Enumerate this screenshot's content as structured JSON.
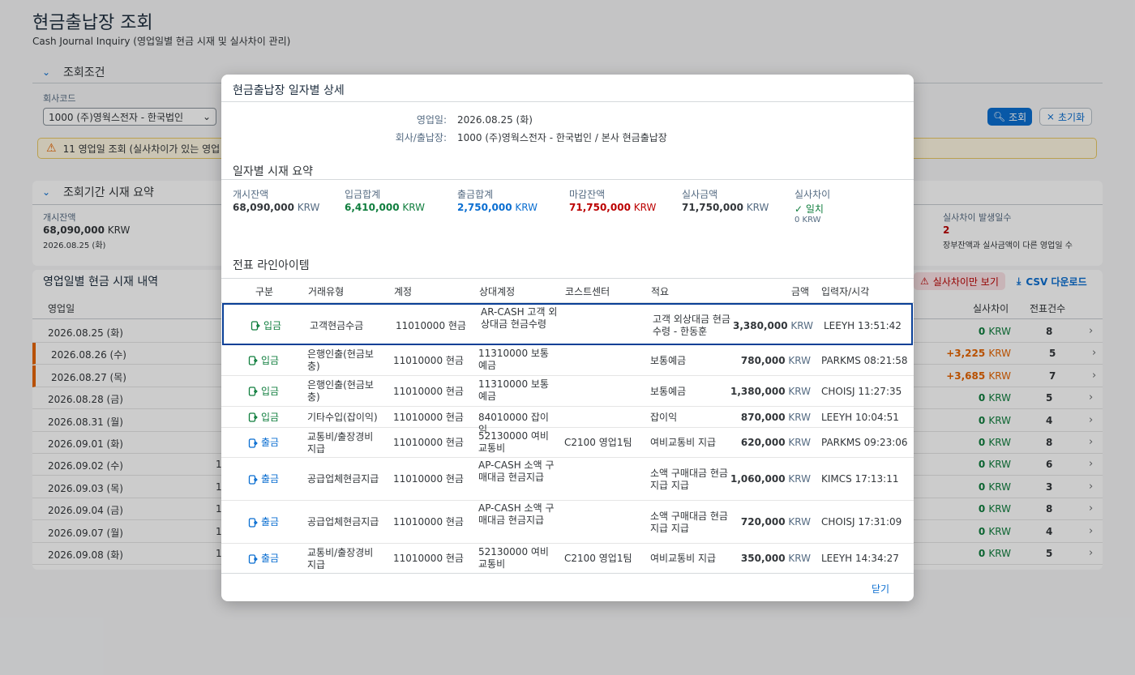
{
  "page": {
    "title": "현금출납장 조회",
    "subtitle": "Cash Journal Inquiry (영업일별 현금 시재 및 실사차이 관리)"
  },
  "filters": {
    "section_label": "조회조건",
    "company_label": "회사코드",
    "company_value": "1000 (주)영웍스전자 - 한국법인",
    "search_label": "조회",
    "reset_label": "초기화",
    "warning_text": "11 영업일 조회 (실사차이가 있는 영업"
  },
  "summary": {
    "section_label": "조회기간 시재 요약",
    "opening_label": "개시잔액",
    "opening_value": "68,090,000",
    "opening_unit": "KRW",
    "opening_date": "2026.08.25 (화)",
    "diff_days_label": "실사차이 발생일수",
    "diff_days_value": "2",
    "diff_days_desc": "장부잔액과 실사금액이 다른 영업일 수"
  },
  "list": {
    "title": "영업일별 현금 시재 내역",
    "only_diff_label": "실사차이만 보기",
    "csv_label": "CSV 다운로드",
    "col_date": "영업일",
    "col_diff": "실사차이",
    "col_count": "전표건수",
    "rows": [
      {
        "date": "2026.08.25 (화)",
        "extra": "",
        "diff": "0",
        "unit": "KRW",
        "count": "8",
        "flag": false
      },
      {
        "date": "2026.08.26 (수)",
        "extra": "",
        "diff": "+3,225",
        "unit": "KRW",
        "count": "5",
        "flag": true
      },
      {
        "date": "2026.08.27 (목)",
        "extra": "",
        "diff": "+3,685",
        "unit": "KRW",
        "count": "7",
        "flag": true
      },
      {
        "date": "2026.08.28 (금)",
        "extra": "",
        "diff": "0",
        "unit": "KRW",
        "count": "5",
        "flag": false
      },
      {
        "date": "2026.08.31 (월)",
        "extra": "",
        "diff": "0",
        "unit": "KRW",
        "count": "4",
        "flag": false
      },
      {
        "date": "2026.09.01 (화)",
        "extra": "",
        "diff": "0",
        "unit": "KRW",
        "count": "8",
        "flag": false
      },
      {
        "date": "2026.09.02 (수)",
        "extra": "1",
        "diff": "0",
        "unit": "KRW",
        "count": "6",
        "flag": false
      },
      {
        "date": "2026.09.03 (목)",
        "extra": "1",
        "diff": "0",
        "unit": "KRW",
        "count": "3",
        "flag": false
      },
      {
        "date": "2026.09.04 (금)",
        "extra": "1",
        "diff": "0",
        "unit": "KRW",
        "count": "8",
        "flag": false
      },
      {
        "date": "2026.09.07 (월)",
        "extra": "1",
        "diff": "0",
        "unit": "KRW",
        "count": "4",
        "flag": false
      },
      {
        "date": "2026.09.08 (화)",
        "extra": "1",
        "diff": "0",
        "unit": "KRW",
        "count": "5",
        "flag": false
      }
    ]
  },
  "dialog": {
    "title": "현금출납장 일자별 상세",
    "biz_date_label": "영업일:",
    "biz_date_value": "2026.08.25 (화)",
    "company_label": "회사/출납장:",
    "company_value": "1000 (주)영웍스전자 - 한국법인 / 본사 현금출납장",
    "daily_section": "일자별 시재 요약",
    "opening_label": "개시잔액",
    "opening_value": "68,090,000",
    "in_label": "입금합계",
    "in_value": "6,410,000",
    "out_label": "출금합계",
    "out_value": "2,750,000",
    "closing_label": "마감잔액",
    "closing_value": "71,750,000",
    "actual_label": "실사금액",
    "actual_value": "71,750,000",
    "diff_label": "실사차이",
    "diff_status": "일치",
    "diff_value": "0 KRW",
    "unit": "KRW",
    "lines_section": "전표 라인아이템",
    "columns": {
      "kind": "구분",
      "type": "거래유형",
      "account": "계정",
      "counter": "상대계정",
      "cost_center": "코스트센터",
      "memo": "적요",
      "amount": "금액",
      "entered": "입력자/시각"
    },
    "lines": [
      {
        "kind": "입금",
        "dir": "in",
        "type": "고객현금수금",
        "account": "11010000 현금",
        "counter": "AR-CASH 고객 외상대금 현금수령",
        "cc": "",
        "memo": "고객 외상대금 현금수령 - 한동훈",
        "amount": "3,380,000",
        "entered": "LEEYH 13:51:42"
      },
      {
        "kind": "입금",
        "dir": "in",
        "type": "은행인출(현금보충)",
        "account": "11010000 현금",
        "counter": "11310000 보통예금",
        "cc": "",
        "memo": "보통예금",
        "amount": "780,000",
        "entered": "PARKMS 08:21:58"
      },
      {
        "kind": "입금",
        "dir": "in",
        "type": "은행인출(현금보충)",
        "account": "11010000 현금",
        "counter": "11310000 보통예금",
        "cc": "",
        "memo": "보통예금",
        "amount": "1,380,000",
        "entered": "CHOISJ 11:27:35"
      },
      {
        "kind": "입금",
        "dir": "in",
        "type": "기타수입(잡이익)",
        "account": "11010000 현금",
        "counter": "84010000 잡이익",
        "cc": "",
        "memo": "잡이익",
        "amount": "870,000",
        "entered": "LEEYH 10:04:51"
      },
      {
        "kind": "출금",
        "dir": "out",
        "type": "교통비/출장경비지급",
        "account": "11010000 현금",
        "counter": "52130000 여비교통비",
        "cc": "C2100 영업1팀",
        "memo": "여비교통비 지급",
        "amount": "620,000",
        "entered": "PARKMS 09:23:06"
      },
      {
        "kind": "출금",
        "dir": "out",
        "type": "공급업체현금지급",
        "account": "11010000 현금",
        "counter": "AP-CASH 소액 구매대금 현금지급",
        "cc": "",
        "memo": "소액 구매대금 현금지급 지급",
        "amount": "1,060,000",
        "entered": "KIMCS 17:13:11"
      },
      {
        "kind": "출금",
        "dir": "out",
        "type": "공급업체현금지급",
        "account": "11010000 현금",
        "counter": "AP-CASH 소액 구매대금 현금지급",
        "cc": "",
        "memo": "소액 구매대금 현금지급 지급",
        "amount": "720,000",
        "entered": "CHOISJ 17:31:09"
      },
      {
        "kind": "출금",
        "dir": "out",
        "type": "교통비/출장경비지급",
        "account": "11010000 현금",
        "counter": "52130000 여비교통비",
        "cc": "C2100 영업1팀",
        "memo": "여비교통비 지급",
        "amount": "350,000",
        "entered": "LEEYH 14:34:27"
      }
    ],
    "close_label": "닫기"
  },
  "colors": {
    "accent": "#0a6ed1",
    "positive": "#107e3e",
    "negative": "#bb0000",
    "warning": "#e76500"
  }
}
